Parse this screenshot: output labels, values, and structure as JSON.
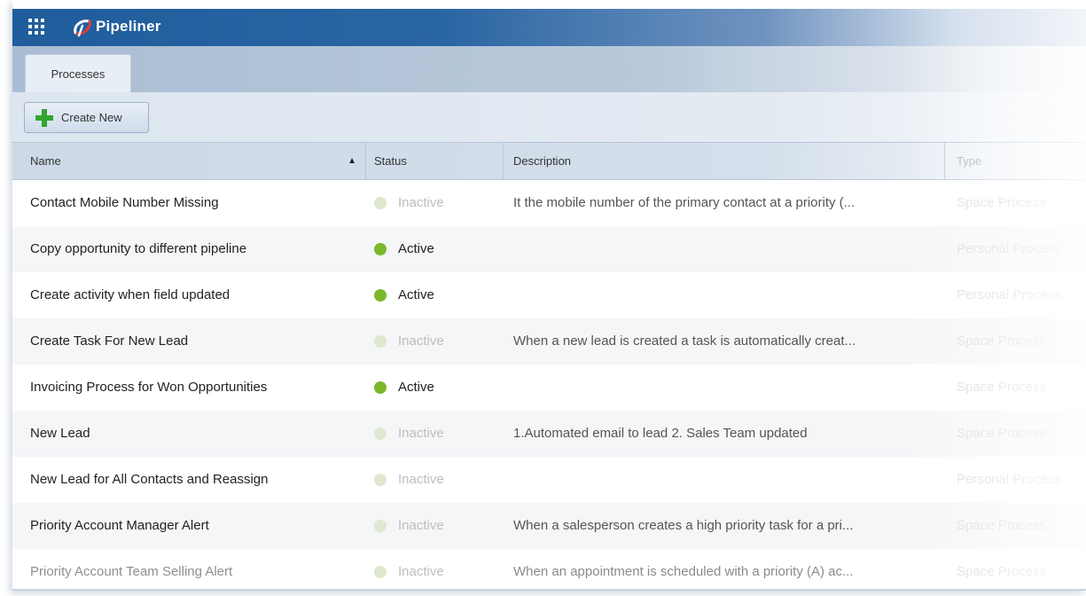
{
  "app": {
    "title": "Pipeliner"
  },
  "tabs": [
    {
      "label": "Processes"
    }
  ],
  "toolbar": {
    "create_label": "Create New"
  },
  "table": {
    "columns": [
      {
        "label": "Name",
        "sort": "ascending"
      },
      {
        "label": "Status"
      },
      {
        "label": "Description"
      },
      {
        "label": "Type"
      }
    ],
    "rows": [
      {
        "name": "Contact Mobile Number Missing",
        "status": "Inactive",
        "description": "It the mobile number of the primary contact at a priority (...",
        "type": "Space Process"
      },
      {
        "name": "Copy opportunity to different pipeline",
        "status": "Active",
        "description": "",
        "type": "Personal Process"
      },
      {
        "name": "Create activity when field updated",
        "status": "Active",
        "description": "",
        "type": "Personal Process"
      },
      {
        "name": "Create Task For New Lead",
        "status": "Inactive",
        "description": "When a new lead is created a task is automatically creat...",
        "type": "Space Process"
      },
      {
        "name": "Invoicing Process for Won Opportunities",
        "status": "Active",
        "description": "",
        "type": "Space Process"
      },
      {
        "name": "New Lead",
        "status": "Inactive",
        "description": "1.Automated email to lead 2. Sales Team updated",
        "type": "Space Process"
      },
      {
        "name": "New Lead for All Contacts and Reassign",
        "status": "Inactive",
        "description": "",
        "type": "Personal Process"
      },
      {
        "name": "Priority Account Manager Alert",
        "status": "Inactive",
        "description": "When a salesperson creates a high priority task for a pri...",
        "type": "Space Process"
      },
      {
        "name": "Priority Account Team Selling Alert",
        "status": "Inactive",
        "description": "When an appointment is scheduled with a priority (A) ac...",
        "type": "Space Process"
      }
    ]
  },
  "colors": {
    "active": "#7ab82a",
    "inactive": "#dfe8cf",
    "brand": "#1f5d9c"
  },
  "icons": {
    "apps": "grid-icon",
    "logo": "pipeliner-logo-icon",
    "create": "plus-icon",
    "sort": "sort-ascending-icon"
  }
}
